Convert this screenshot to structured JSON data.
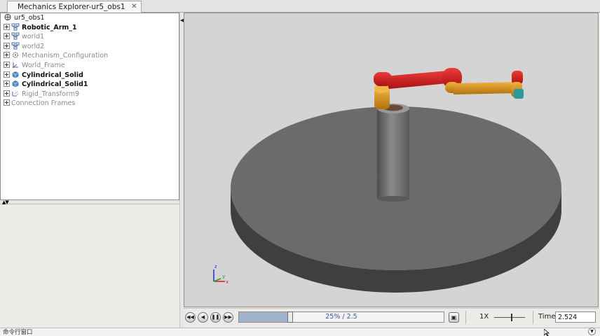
{
  "window": {
    "tab_title": "Mechanics Explorer-ur5_obs1",
    "tab_close": "✕"
  },
  "tree": {
    "root": {
      "label": "ur5_obs1",
      "icon": "mechanism-icon"
    },
    "items": [
      {
        "label": "Robotic_Arm_1",
        "icon": "subsystem-icon",
        "style": "active"
      },
      {
        "label": "world1",
        "icon": "subsystem-icon",
        "style": "dim"
      },
      {
        "label": "world2",
        "icon": "subsystem-icon",
        "style": "dim"
      },
      {
        "label": "Mechanism_Configuration",
        "icon": "gear-icon",
        "style": "dim"
      },
      {
        "label": "World_Frame",
        "icon": "frame-icon",
        "style": "dim"
      },
      {
        "label": "Cylindrical_Solid",
        "icon": "solid-cube-icon",
        "style": "active"
      },
      {
        "label": "Cylindrical_Solid1",
        "icon": "solid-cube-icon",
        "style": "active"
      },
      {
        "label": "Rigid_Transform9",
        "icon": "transform-icon",
        "style": "dim"
      },
      {
        "label": "Connection Frames",
        "icon": "",
        "style": "dim"
      }
    ]
  },
  "playback": {
    "progress": 0.25,
    "progress_text": "25% / 2.5",
    "speed_label": "1X",
    "time_label": "Time",
    "time_value": "2.524"
  },
  "axes": {
    "x": "x",
    "y": "y",
    "z": "z"
  },
  "command_window": {
    "label": "命令行窗口"
  },
  "colors": {
    "ground": "#6b6b6b",
    "pillar": "#6e6e6e",
    "arm_red": "#d81f1f",
    "arm_orange": "#d99420",
    "accent_blue": "#9fb2cc"
  }
}
